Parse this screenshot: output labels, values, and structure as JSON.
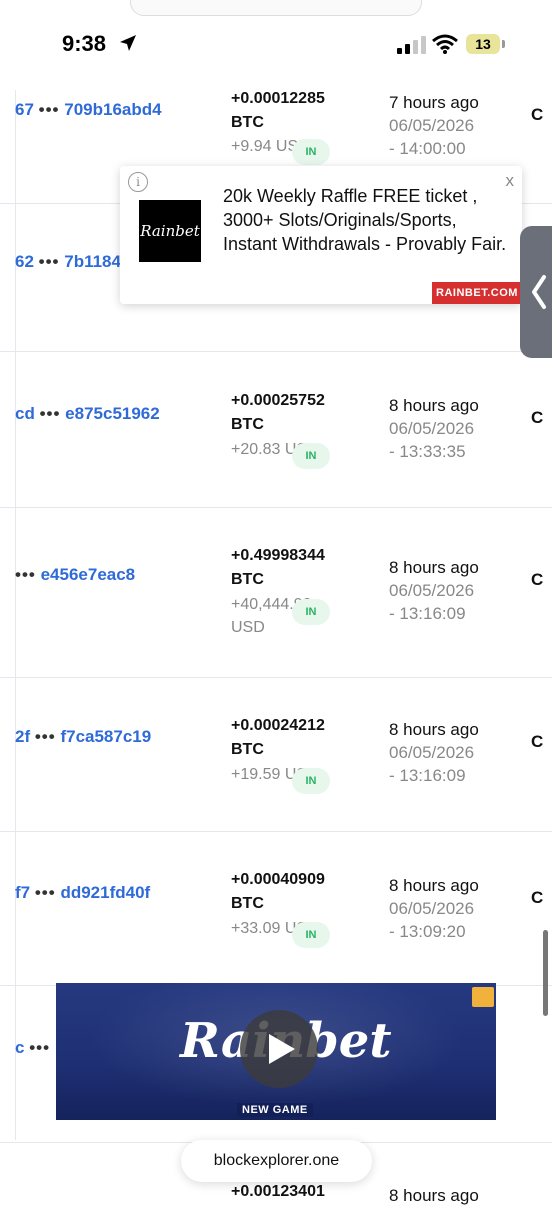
{
  "status_bar": {
    "time": "9:38",
    "battery": "13"
  },
  "rows": [
    {
      "hash_left": "67",
      "hash_right": "709b16abd4",
      "amount": "+0.00012285",
      "unit": "BTC",
      "usd": "+9.94 USD",
      "direction": "IN",
      "ago": "7 hours ago",
      "date": "06/05/2026",
      "time": "- 14:00:00"
    },
    {
      "hash_left": "62",
      "hash_right": "7b1184"
    },
    {
      "hash_left": "cd",
      "hash_right": "e875c51962",
      "amount": "+0.00025752",
      "unit": "BTC",
      "usd": "+20.83 USD",
      "direction": "IN",
      "ago": "8 hours ago",
      "date": "06/05/2026",
      "time": "- 13:33:35"
    },
    {
      "hash_left": "",
      "hash_right": "e456e7eac8",
      "amount": "+0.49998344",
      "unit": "BTC",
      "usd": "+40,444.90 USD",
      "direction": "IN",
      "ago": "8 hours ago",
      "date": "06/05/2026",
      "time": "- 13:16:09"
    },
    {
      "hash_left": "2f",
      "hash_right": "f7ca587c19",
      "amount": "+0.00024212",
      "unit": "BTC",
      "usd": "+19.59 USD",
      "direction": "IN",
      "ago": "8 hours ago",
      "date": "06/05/2026",
      "time": "- 13:16:09"
    },
    {
      "hash_left": "f7",
      "hash_right": "dd921fd40f",
      "amount": "+0.00040909",
      "unit": "BTC",
      "usd": "+33.09 USD",
      "direction": "IN",
      "ago": "8 hours ago",
      "date": "06/05/2026",
      "time": "- 13:09:20"
    },
    {
      "hash_left": "c"
    },
    {
      "amount": "+0.00123401",
      "ago": "8 hours ago"
    }
  ],
  "ad_popup": {
    "logo": "Rainbet",
    "text": "20k Weekly Raffle FREE ticket , 3000+ Slots/Originals/Sports, Instant Withdrawals - Provably Fair.",
    "brand": "RAINBET.COM",
    "close": "x",
    "info": "i"
  },
  "video_ad": {
    "logo": "Rainbet",
    "tag": "NEW GAME"
  },
  "browser": {
    "url": "blockexplorer.one"
  },
  "colors": {
    "hash_link": "#2f6bd8",
    "in_badge_text": "#28b463",
    "in_badge_bg": "#e7f7ec",
    "ad_brand": "#d62f2f"
  },
  "icons": [
    "location-arrow-icon",
    "cellular-signal-icon",
    "wifi-icon",
    "battery-icon",
    "info-icon",
    "close-icon",
    "chevron-left-icon",
    "play-icon"
  ]
}
